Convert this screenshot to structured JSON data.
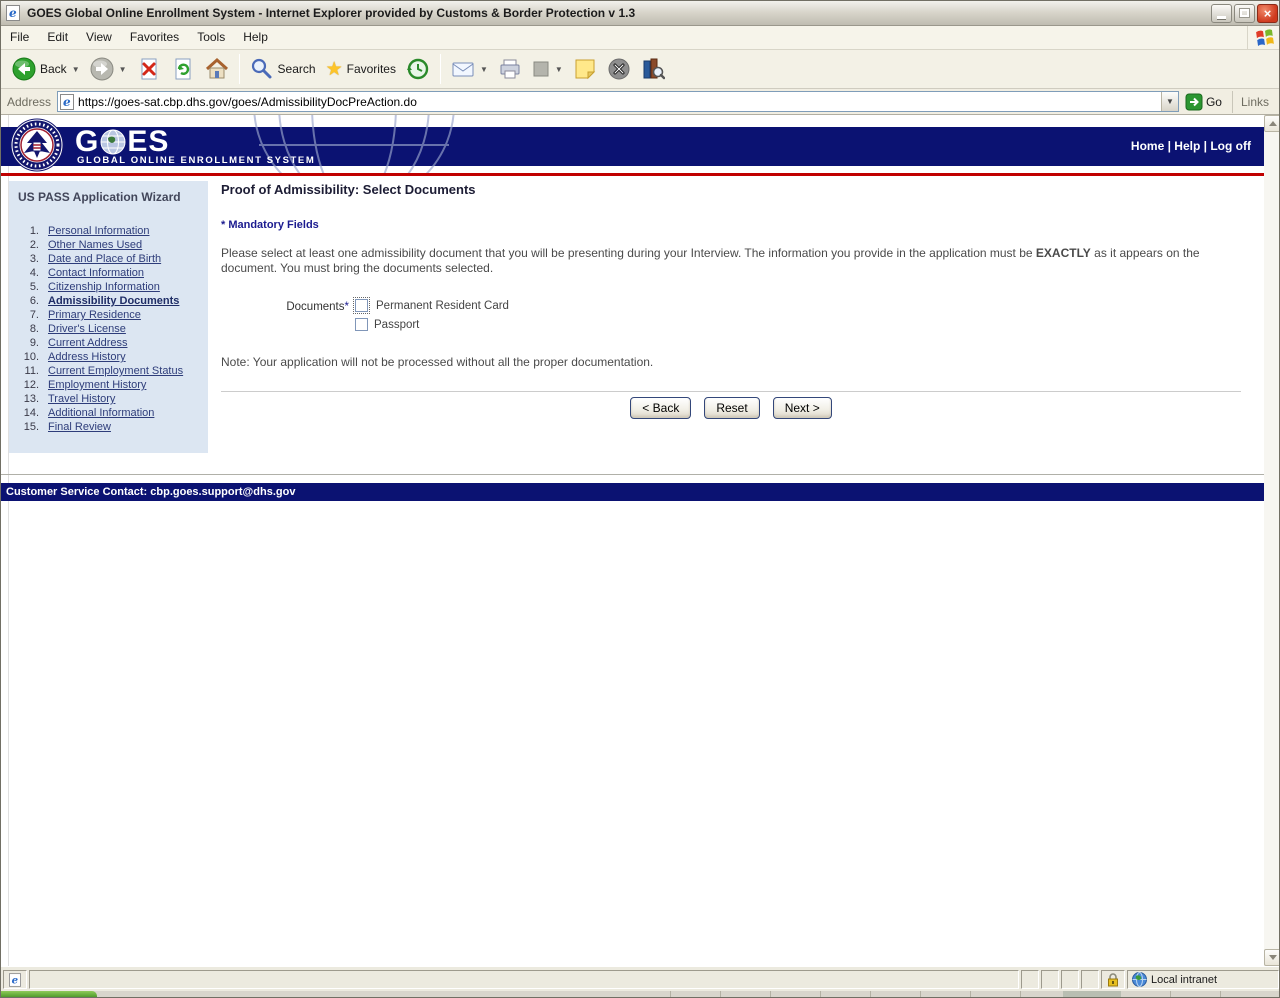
{
  "window": {
    "title": "GOES Global Online Enrollment System - Internet Explorer provided by Customs & Border Protection v 1.3"
  },
  "menu": {
    "items": [
      "File",
      "Edit",
      "View",
      "Favorites",
      "Tools",
      "Help"
    ]
  },
  "toolbar": {
    "back_label": "Back",
    "search_label": "Search",
    "favorites_label": "Favorites"
  },
  "address_bar": {
    "label": "Address",
    "url": "https://goes-sat.cbp.dhs.gov/goes/AdmissibilityDocPreAction.do",
    "go_label": "Go",
    "links_label": "Links"
  },
  "site_header": {
    "logo_g": "G",
    "logo_es": "ES",
    "subtitle": "GLOBAL ONLINE ENROLLMENT SYSTEM",
    "nav": {
      "home": "Home",
      "sep1": " | ",
      "help": "Help",
      "sep2": " | ",
      "logoff": "Log off"
    }
  },
  "sidebar": {
    "title": "US PASS Application Wizard",
    "items": [
      {
        "num": "1.",
        "label": "Personal Information"
      },
      {
        "num": "2.",
        "label": "Other Names Used"
      },
      {
        "num": "3.",
        "label": "Date and Place of Birth"
      },
      {
        "num": "4.",
        "label": "Contact Information"
      },
      {
        "num": "5.",
        "label": "Citizenship Information"
      },
      {
        "num": "6.",
        "label": "Admissibility Documents"
      },
      {
        "num": "7.",
        "label": "Primary Residence"
      },
      {
        "num": "8.",
        "label": "Driver's License"
      },
      {
        "num": "9.",
        "label": "Current Address"
      },
      {
        "num": "10.",
        "label": "Address History"
      },
      {
        "num": "11.",
        "label": "Current Employment Status"
      },
      {
        "num": "12.",
        "label": "Employment History"
      },
      {
        "num": "13.",
        "label": "Travel History"
      },
      {
        "num": "14.",
        "label": "Additional Information"
      },
      {
        "num": "15.",
        "label": "Final Review"
      }
    ],
    "current_step": "Admissibility Documents"
  },
  "content": {
    "page_title": "Proof of Admissibility: Select Documents",
    "mandatory_note": "* Mandatory Fields",
    "instructions_pre": "Please select at least one admissibility document that you will be presenting during your Interview. The information you provide in the application must be ",
    "instructions_bold": "EXACTLY",
    "instructions_post": " as it appears on the document. You must bring the documents selected.",
    "documents_label": "Documents",
    "required_marker": "*",
    "options": [
      {
        "label": "Permanent Resident Card",
        "checked": false
      },
      {
        "label": "Passport",
        "checked": false
      }
    ],
    "note": "Note: Your application will not be processed without all the proper documentation.",
    "buttons": {
      "back": "< Back",
      "reset": "Reset",
      "next": "Next >"
    }
  },
  "page_footer": {
    "contact": "Customer Service Contact: cbp.goes.support@dhs.gov"
  },
  "status_bar": {
    "zone": "Local intranet"
  },
  "colors": {
    "navy": "#0b1272",
    "red_accent": "#c00000",
    "sidebar_bg": "#dce6f2",
    "link": "#2e3d7a",
    "go_green": "#2c9631"
  }
}
